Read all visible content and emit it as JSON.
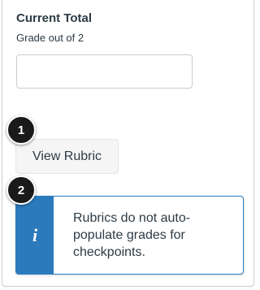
{
  "grade_panel": {
    "title": "Current Total",
    "subtitle": "Grade out of 2",
    "grade_value": ""
  },
  "callouts": [
    "1",
    "2"
  ],
  "rubric_button_label": "View Rubric",
  "alert": {
    "icon": "info-icon",
    "icon_glyph": "i",
    "message": "Rubrics do not auto-populate grades for checkpoints.",
    "color": "#2b7abc"
  }
}
